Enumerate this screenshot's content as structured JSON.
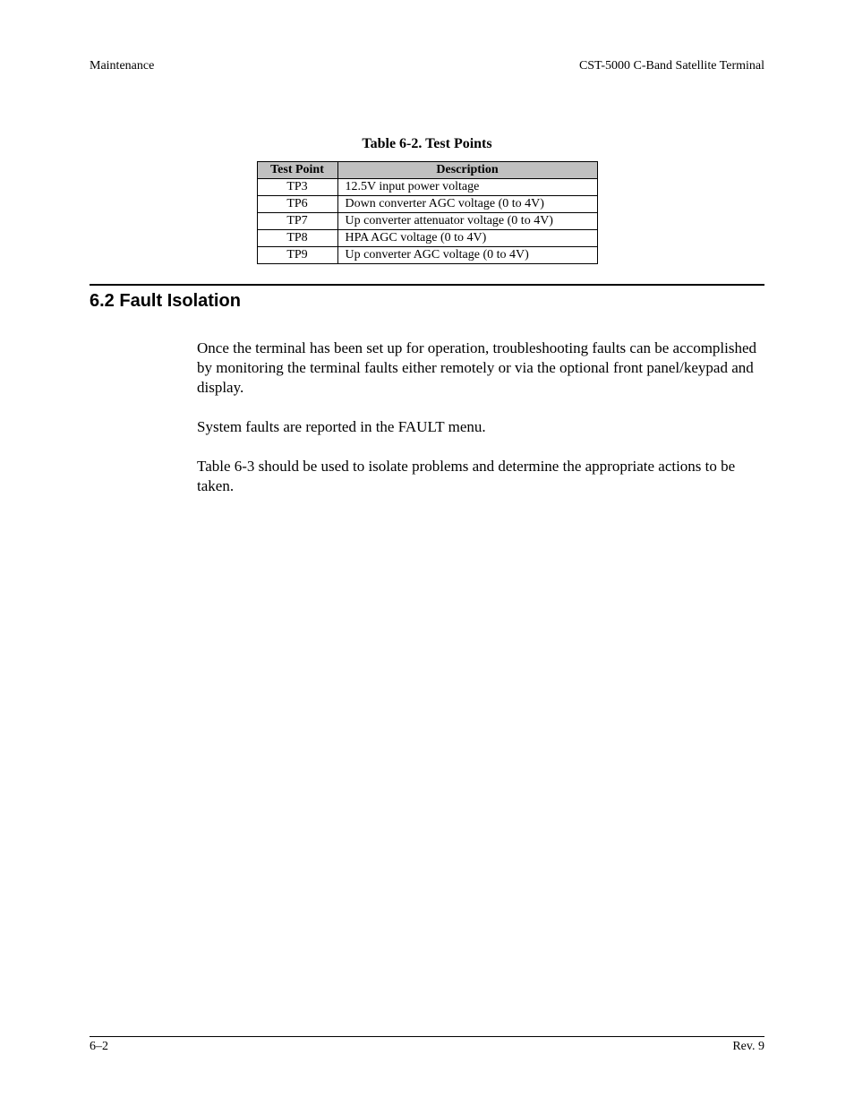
{
  "header": {
    "left": "Maintenance",
    "right": "CST-5000 C-Band Satellite Terminal"
  },
  "table": {
    "caption": "Table 6-2.  Test Points",
    "headers": {
      "col1": "Test Point",
      "col2": "Description"
    },
    "rows": [
      {
        "tp": "TP3",
        "desc": "12.5V input power voltage"
      },
      {
        "tp": "TP6",
        "desc": "Down converter AGC voltage (0 to 4V)"
      },
      {
        "tp": "TP7",
        "desc": "Up converter attenuator voltage (0 to 4V)"
      },
      {
        "tp": "TP8",
        "desc": "HPA AGC voltage (0 to 4V)"
      },
      {
        "tp": "TP9",
        "desc": "Up converter AGC voltage (0 to 4V)"
      }
    ]
  },
  "section": {
    "heading": "6.2  Fault Isolation",
    "para1": "Once the terminal has been set up for operation, troubleshooting faults can be accomplished by monitoring the terminal faults either remotely or via the optional front panel/keypad and display.",
    "para2": "System faults are reported in the FAULT menu.",
    "para3": "Table 6-3 should be used to isolate problems and determine the appropriate actions to be taken."
  },
  "footer": {
    "left": "6–2",
    "right": "Rev. 9"
  }
}
